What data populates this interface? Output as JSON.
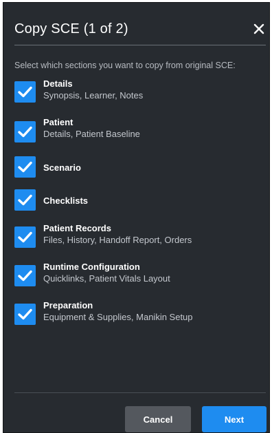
{
  "dialog": {
    "title": "Copy SCE (1 of 2)",
    "close_icon": "close-icon",
    "instruction": "Select which sections you want to copy from original SCE:",
    "accent_color": "#1e8cf0",
    "background_color": "#272b30"
  },
  "sections": [
    {
      "label": "Details",
      "sub": "Synopsis, Learner, Notes",
      "checked": true
    },
    {
      "label": "Patient",
      "sub": "Details, Patient Baseline",
      "checked": true
    },
    {
      "label": "Scenario",
      "sub": "",
      "checked": true
    },
    {
      "label": "Checklists",
      "sub": "",
      "checked": true
    },
    {
      "label": "Patient Records",
      "sub": "Files, History, Handoff Report, Orders",
      "checked": true
    },
    {
      "label": "Runtime Configuration",
      "sub": "Quicklinks, Patient Vitals Layout",
      "checked": true
    },
    {
      "label": "Preparation",
      "sub": "Equipment & Supplies, Manikin Setup",
      "checked": true
    }
  ],
  "footer": {
    "cancel_label": "Cancel",
    "next_label": "Next"
  }
}
